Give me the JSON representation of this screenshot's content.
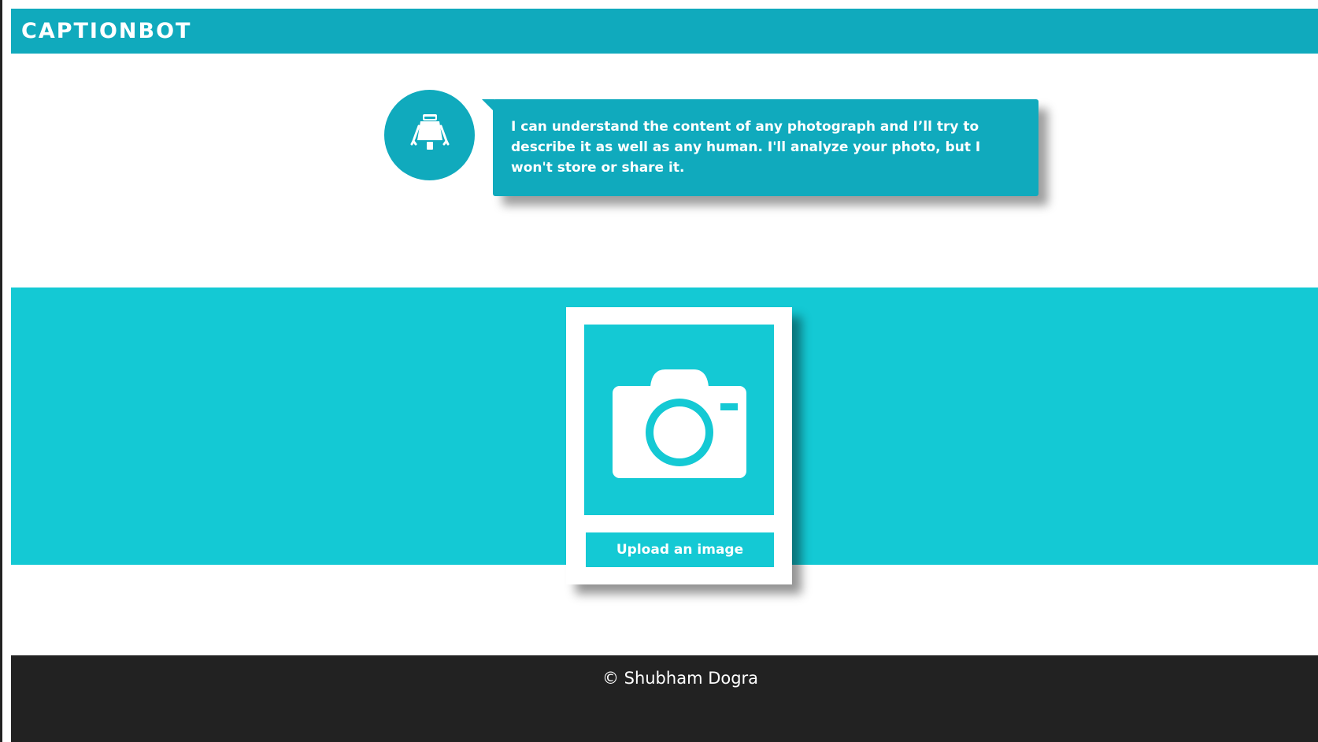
{
  "header": {
    "brand": "CAPTIONBOT"
  },
  "bot": {
    "avatar_icon": "robot-icon",
    "message": "I can understand the content of any photograph and I’ll try to describe it as well as any human. I'll analyze your photo, but I won't store or share it."
  },
  "upload": {
    "icon": "camera-icon",
    "button_label": "Upload an image"
  },
  "footer": {
    "copyright": "© Shubham Dogra"
  },
  "colors": {
    "header_bg": "#10aabd",
    "band_bg": "#14c9d4",
    "footer_bg": "#222222",
    "text_on_accent": "#ffffff"
  }
}
